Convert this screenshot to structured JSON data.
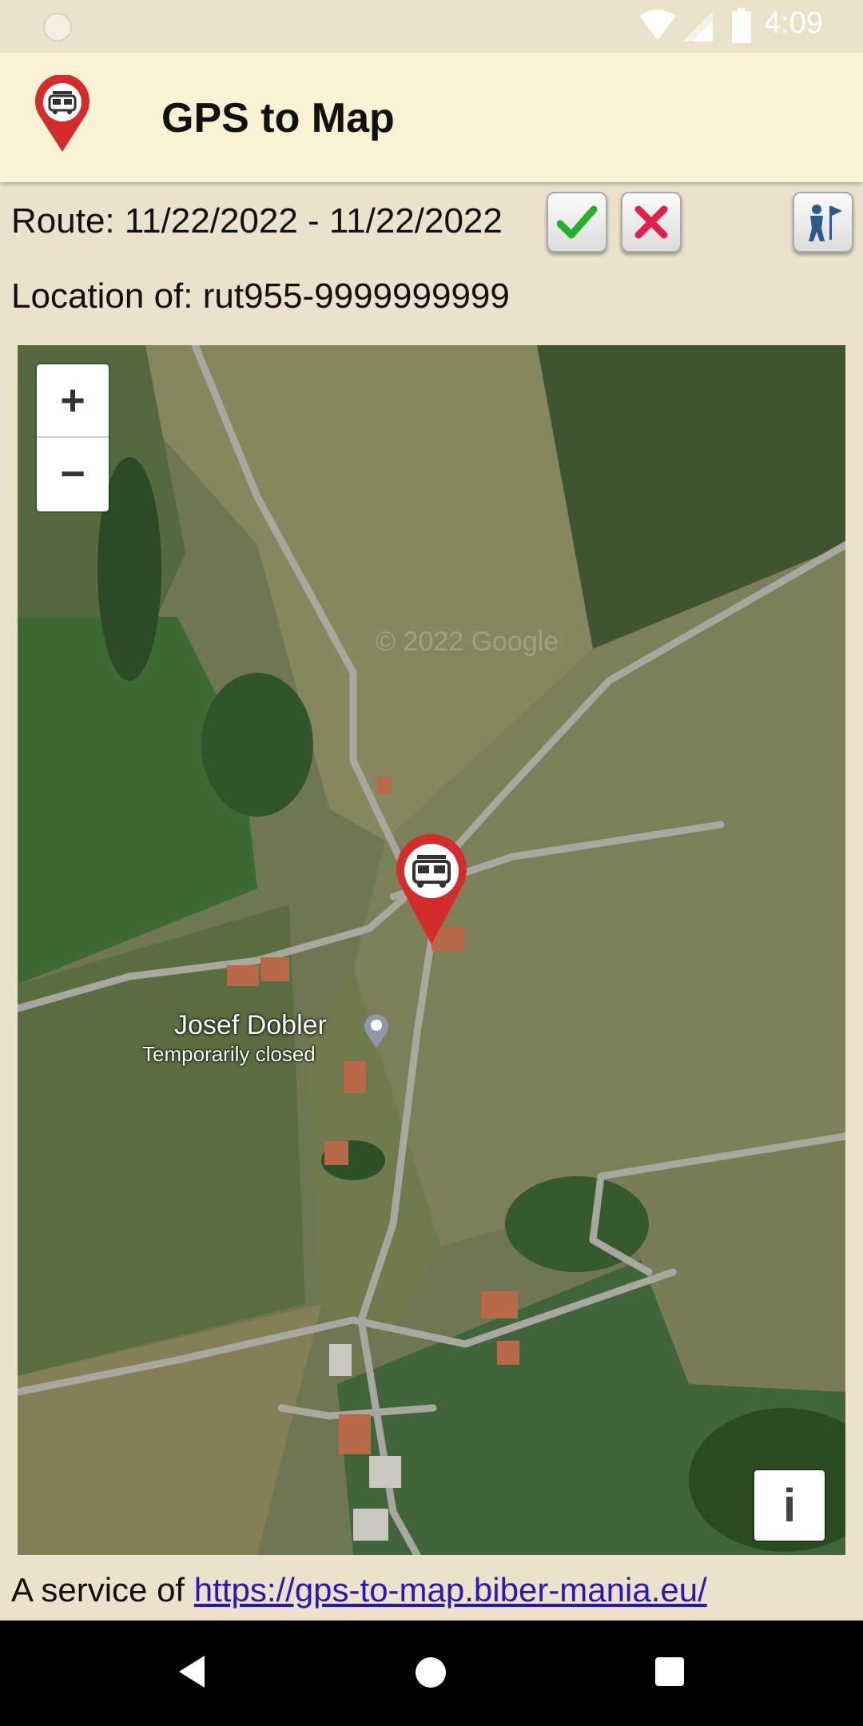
{
  "status_bar": {
    "time": "4:09",
    "icons": [
      "notification-dot-icon",
      "wifi-icon",
      "cell-signal-icon",
      "battery-icon"
    ]
  },
  "app_bar": {
    "title": "GPS to Map",
    "logo_icon": "van-map-pin-icon"
  },
  "route": {
    "label": "Route:",
    "date_range": "11/22/2022 - 11/22/2022",
    "confirm_icon": "checkmark-icon",
    "cancel_icon": "close-x-icon",
    "route_icon": "hiker-flag-icon"
  },
  "location": {
    "label": "Location of:",
    "device_id": "rut955-9999999999"
  },
  "map": {
    "zoom_in_label": "+",
    "zoom_out_label": "−",
    "watermark": "© 2022 Google",
    "poi": {
      "name": "Josef Dobler",
      "status": "Temporarily closed",
      "icon": "place-pin-icon"
    },
    "marker_icon": "van-map-pin-icon",
    "info_label": "i"
  },
  "footer": {
    "prefix": "A service of ",
    "link_text": "https://gps-to-map.biber-mania.eu/"
  },
  "colors": {
    "background": "#ece2cc",
    "app_bar": "#fbf1d3",
    "marker_red": "#d42b2b",
    "confirm_green": "#27b02a",
    "cancel_red": "#e0204a",
    "link": "#2a18b4"
  }
}
